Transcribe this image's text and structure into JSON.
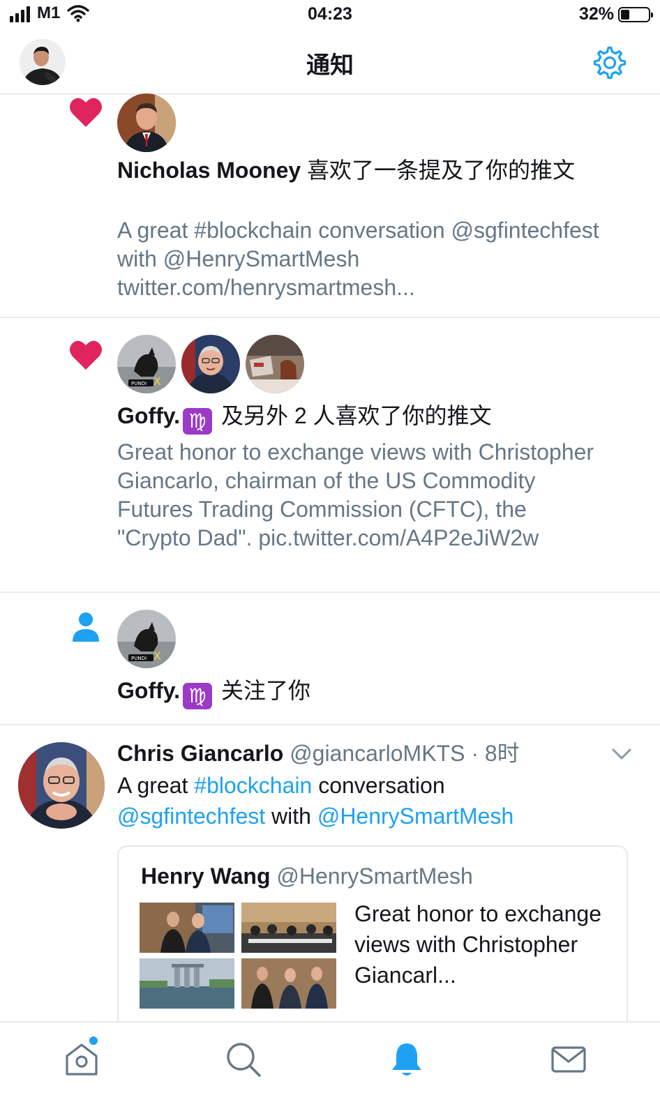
{
  "status_bar": {
    "carrier": "M1",
    "time": "04:23",
    "battery_percent": "32%",
    "battery_level": 0.32,
    "signal_bars": 4
  },
  "nav": {
    "title": "通知",
    "settings_icon": "gear-icon"
  },
  "colors": {
    "accent": "#1da1f2",
    "like": "#e0245e",
    "secondary_text": "#657786",
    "divider": "#e6ecf0",
    "emoji_bg": "#9a3ac7"
  },
  "notifications": [
    {
      "type": "like",
      "icon": "heart-icon",
      "actor": "Nicholas Mooney",
      "action": "喜欢了一条提及了你的推文",
      "preview": "A great #blockchain conversation @sgfintechfest with @HenrySmartMesh twitter.com/henrysmartmesh..."
    },
    {
      "type": "like",
      "icon": "heart-icon",
      "actor": "Goffy.",
      "emoji": "♍",
      "action": "及另外 2 人喜欢了你的推文",
      "preview": "Great honor to exchange views with Christopher Giancarlo, chairman of the US Commodity Futures Trading Commission (CFTC), the \"Crypto Dad\". pic.twitter.com/A4P2eJiW2w"
    },
    {
      "type": "follow",
      "icon": "person-icon",
      "actor": "Goffy.",
      "emoji": "♍",
      "action": "关注了你"
    }
  ],
  "tweet": {
    "name": "Chris Giancarlo",
    "handle": "@giancarloMKTS",
    "separator": "·",
    "time": "8时",
    "text_prefix": "A great ",
    "hashtag": "#blockchain",
    "text_mid": " conversation",
    "mention1": "@sgfintechfest",
    "text_with": " with ",
    "mention2": "@HenrySmartMesh",
    "quoted": {
      "name": "Henry Wang",
      "handle": "@HenrySmartMesh",
      "text": "Great honor to exchange views with Christopher Giancarl..."
    }
  },
  "tabbar": {
    "tabs": [
      "home-icon",
      "search-icon",
      "notifications-bell-icon",
      "messages-mail-icon"
    ],
    "active": "notifications-bell-icon"
  }
}
